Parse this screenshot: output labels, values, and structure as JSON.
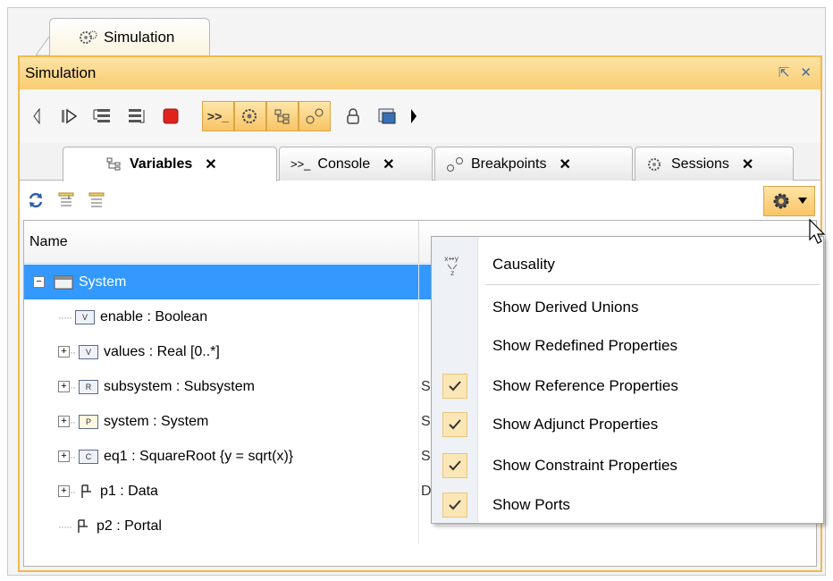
{
  "doc_tab": {
    "label": "Simulation",
    "icon": "gears-icon"
  },
  "panel": {
    "title": "Simulation",
    "controls": [
      "restore-icon",
      "close-icon"
    ]
  },
  "toolbar": {
    "icons": [
      "scroll-left-icon",
      "step-icon",
      "step-into-icon",
      "step-out-icon",
      "stop-icon",
      "console-toggle-icon",
      "sessions-toggle-icon",
      "variables-toggle-icon",
      "breakpoints-toggle-icon",
      "lock-icon",
      "export-icon",
      "scroll-right-icon"
    ]
  },
  "tabs": [
    {
      "label": "Variables",
      "icon": "variables-icon",
      "active": true
    },
    {
      "label": "Console",
      "icon": "console-icon",
      "active": false
    },
    {
      "label": "Breakpoints",
      "icon": "breakpoints-icon",
      "active": false
    },
    {
      "label": "Sessions",
      "icon": "gears-icon",
      "active": false
    }
  ],
  "tree_toolbar": {
    "icons": [
      "refresh-icon",
      "expand-all-icon",
      "collapse-all-icon"
    ],
    "options_icon": "gear-icon"
  },
  "table": {
    "columns": [
      "Name",
      ""
    ],
    "rows": [
      {
        "name": "System",
        "value_snippet": "",
        "icon": "system-icon",
        "selected": true,
        "expander": "−"
      },
      {
        "name": "enable : Boolean",
        "value_snippet": "",
        "icon": "value-property-icon",
        "expander": ""
      },
      {
        "name": "values : Real [0..*]",
        "value_snippet": "",
        "icon": "value-property-icon",
        "expander": "+"
      },
      {
        "name": "subsystem : Subsystem",
        "value_snippet": "S",
        "icon": "reference-property-icon",
        "expander": "+"
      },
      {
        "name": "system : System",
        "value_snippet": "S",
        "icon": "part-property-icon",
        "expander": "+"
      },
      {
        "name": "eq1 : SquareRoot {y = sqrt(x)}",
        "value_snippet": "S",
        "icon": "constraint-property-icon",
        "expander": "+"
      },
      {
        "name": "p1 : Data",
        "value_snippet": "D",
        "icon": "port-icon",
        "expander": "+"
      },
      {
        "name": "p2 : Portal",
        "value_snippet": "",
        "icon": "port-icon",
        "expander": ""
      }
    ]
  },
  "menu": {
    "items": [
      {
        "label": "Causality",
        "checked": false,
        "icon": "causality-icon"
      },
      {
        "label": "Show Derived Unions",
        "checked": false
      },
      {
        "label": "Show Redefined Properties",
        "checked": false
      },
      {
        "label": "Show Reference Properties",
        "checked": true
      },
      {
        "label": "Show Adjunct Properties",
        "checked": true
      },
      {
        "label": "Show Constraint Properties",
        "checked": true
      },
      {
        "label": "Show Ports",
        "checked": true
      }
    ]
  },
  "colors": {
    "accent": "#f9cd73",
    "selection": "#3399ff",
    "border": "#f0b94d"
  }
}
